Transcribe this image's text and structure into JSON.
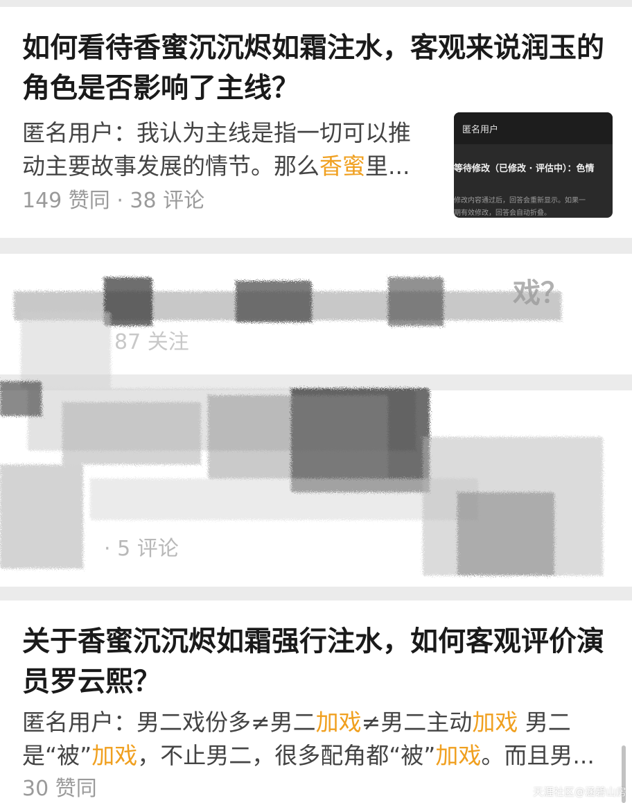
{
  "feed": {
    "item1": {
      "title": "如何看待香蜜沉沉烬如霜注水，客观来说润玉的角色是否影响了主线？",
      "excerpt_line1": "匿名用户：我认为主线是指一切可以推",
      "excerpt_line2_a": "动主要故事发展的情节。那么",
      "excerpt_line2_hl": "香蜜",
      "excerpt_line2_b": "里...",
      "meta": "149 赞同 · 38 评论",
      "thumbnail": {
        "header": "匿名用户",
        "status": "等待修改（已修改 · 评估中）：色情",
        "note1": "修改内容通过后，回答会重新显示。如果一",
        "note2": "期有效修改，回答会自动折叠。"
      }
    },
    "item2": {
      "title_fragment": "戏？",
      "meta_fragment": "87 关注"
    },
    "item3": {
      "meta_fragment": "· 5 评论"
    },
    "item4": {
      "title": "关于香蜜沉沉烬如霜强行注水，如何客观评价演员罗云熙？",
      "excerpt_line1_a": "匿名用户：男二戏份多≠男二",
      "hl_1": "加戏",
      "excerpt_line1_b": "≠男二主动",
      "hl_2": "加戏",
      "excerpt_line1_c": " 男二",
      "excerpt_line2_a": "是“被”",
      "hl_3": "加戏",
      "excerpt_line2_b": "，不止男二，很多配角都“被”",
      "hl_4": "加戏",
      "excerpt_line2_c": "。而且男...",
      "meta": "30 赞同"
    }
  },
  "watermark": "天涯社区@涵碧山房",
  "colors": {
    "highlight": "#f0a020",
    "title": "#1a1a1a",
    "excerpt": "#444444",
    "meta": "#9a9a9a",
    "separator": "#ebebeb",
    "card": "#ffffff"
  }
}
